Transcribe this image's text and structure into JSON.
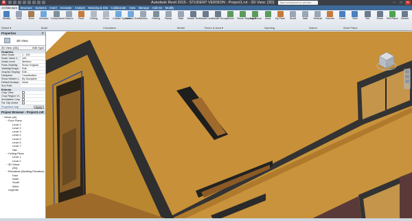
{
  "window": {
    "title": "Autodesk Revit 2016 - STUDENT VERSION -  Project1.rvt - 3D View: {3D}",
    "search_placeholder": "Type a keyword or phrase",
    "app_icon": "R"
  },
  "tabs": [
    "Architecture",
    "Structure",
    "Systems",
    "Insert",
    "Annotate",
    "Analyze",
    "Massing & Site",
    "Collaborate",
    "View",
    "Manage",
    "Add-Ins",
    "Modify"
  ],
  "active_tab": "Architecture",
  "ribbon": {
    "buttons": [
      {
        "label": "Modify",
        "icon": "cursor-icon",
        "color": "#4a7fc1"
      },
      {
        "label": "Wall",
        "icon": "wall-icon",
        "color": "#9aa6b5"
      },
      {
        "label": "Door",
        "icon": "door-icon",
        "color": "#a67c52"
      },
      {
        "label": "Window",
        "icon": "window-icon",
        "color": "#6fa8dc"
      },
      {
        "label": "Component",
        "icon": "component-icon",
        "color": "#7d8f9c"
      },
      {
        "label": "Column",
        "icon": "column-icon",
        "color": "#9aa6b5"
      },
      {
        "label": "Roof",
        "icon": "roof-icon",
        "color": "#c77a3b"
      },
      {
        "label": "Ceiling",
        "icon": "ceiling-icon",
        "color": "#b0bac6"
      },
      {
        "label": "Floor",
        "icon": "floor-icon",
        "color": "#b0bac6"
      },
      {
        "label": "Curtain System",
        "icon": "curtain-system-icon",
        "color": "#6fa8dc"
      },
      {
        "label": "Curtain Grid",
        "icon": "curtain-grid-icon",
        "color": "#6fa8dc"
      },
      {
        "label": "Mullion",
        "icon": "mullion-icon",
        "color": "#9aa6b5"
      },
      {
        "label": "Railing",
        "icon": "railing-icon",
        "color": "#7d8f9c"
      },
      {
        "label": "Ramp",
        "icon": "ramp-icon",
        "color": "#9aa6b5"
      },
      {
        "label": "Stair",
        "icon": "stair-icon",
        "color": "#9aa6b5"
      },
      {
        "label": "Model Text",
        "icon": "model-text-icon",
        "color": "#6b7a8d"
      },
      {
        "label": "Model Line",
        "icon": "model-line-icon",
        "color": "#6b7a8d"
      },
      {
        "label": "Model Group",
        "icon": "model-group-icon",
        "color": "#6b7a8d"
      },
      {
        "label": "Room",
        "icon": "room-icon",
        "color": "#5b9b5b"
      },
      {
        "label": "Room Separator",
        "icon": "room-separator-icon",
        "color": "#5b9b5b"
      },
      {
        "label": "Tag Room",
        "icon": "tag-room-icon",
        "color": "#5b9b5b"
      },
      {
        "label": "Area",
        "icon": "area-icon",
        "color": "#5b9b5b"
      },
      {
        "label": "By Face",
        "icon": "by-face-icon",
        "color": "#c77a3b"
      },
      {
        "label": "Shaft",
        "icon": "shaft-icon",
        "color": "#9aa6b5"
      },
      {
        "label": "Wall",
        "icon": "wall-opening-icon",
        "color": "#9aa6b5"
      },
      {
        "label": "Vertical",
        "icon": "vertical-icon",
        "color": "#9aa6b5"
      },
      {
        "label": "Dormer",
        "icon": "dormer-icon",
        "color": "#c77a3b"
      },
      {
        "label": "Level",
        "icon": "level-icon",
        "color": "#4a7fc1"
      },
      {
        "label": "Grid",
        "icon": "grid-icon",
        "color": "#4a7fc1"
      },
      {
        "label": "Set",
        "icon": "set-icon",
        "color": "#6b7a8d"
      },
      {
        "label": "Show",
        "icon": "show-icon",
        "color": "#6b7a8d"
      },
      {
        "label": "Ref Plane",
        "icon": "ref-plane-icon",
        "color": "#4fa34f"
      },
      {
        "label": "Viewer",
        "icon": "viewer-icon",
        "color": "#6b7a8d"
      }
    ],
    "panels": [
      "Select ▾",
      "Build",
      "Circulation",
      "Model",
      "Room & Area ▾",
      "Opening",
      "Datum",
      "Work Plane"
    ]
  },
  "properties": {
    "header": "Properties",
    "type_name": "3D View",
    "selector": "3D View: {3D}",
    "edit_type": "Edit Type",
    "group_graphics": "Graphics",
    "rows": [
      {
        "k": "View Scale",
        "v": "1 : 100"
      },
      {
        "k": "Scale Value  1:",
        "v": "100"
      },
      {
        "k": "Detail Level",
        "v": "Medium"
      },
      {
        "k": "Parts Visibility",
        "v": "Show Original"
      },
      {
        "k": "Visibility/Graph...",
        "v": "Edit..."
      },
      {
        "k": "Graphic Display ...",
        "v": "Edit..."
      },
      {
        "k": "Discipline",
        "v": "Coordination"
      },
      {
        "k": "Show Hidden L...",
        "v": "By Discipline"
      },
      {
        "k": "Default Analysi...",
        "v": "None"
      },
      {
        "k": "Sun Path",
        "v": ""
      }
    ],
    "group_extents": "Extents",
    "extent_rows": [
      {
        "k": "Crop View",
        "v": ""
      },
      {
        "k": "Crop Region Vi...",
        "v": ""
      },
      {
        "k": "Annotation Crop",
        "v": ""
      },
      {
        "k": "Far Clip Active",
        "v": ""
      }
    ],
    "help": "Properties help",
    "apply": "Apply"
  },
  "browser": {
    "header": "Project Browser - Project1.rvt",
    "items": [
      {
        "t": "Views (all)",
        "lvl": 0,
        "tog": "−"
      },
      {
        "t": "Floor Plans",
        "lvl": 1,
        "tog": "−"
      },
      {
        "t": "Level 1",
        "lvl": 2,
        "tog": ""
      },
      {
        "t": "Level 2",
        "lvl": 2,
        "tog": ""
      },
      {
        "t": "Level 3",
        "lvl": 2,
        "tog": ""
      },
      {
        "t": "Level 4",
        "lvl": 2,
        "tog": ""
      },
      {
        "t": "Level 5",
        "lvl": 2,
        "tog": ""
      },
      {
        "t": "Level 6",
        "lvl": 2,
        "tog": ""
      },
      {
        "t": "Level 7",
        "lvl": 2,
        "tog": ""
      },
      {
        "t": "Site",
        "lvl": 2,
        "tog": ""
      },
      {
        "t": "Ceiling Plans",
        "lvl": 1,
        "tog": "−"
      },
      {
        "t": "Level 1",
        "lvl": 2,
        "tog": ""
      },
      {
        "t": "Level 2",
        "lvl": 2,
        "tog": ""
      },
      {
        "t": "3D Views",
        "lvl": 1,
        "tog": "−"
      },
      {
        "t": "{3D}",
        "lvl": 2,
        "tog": ""
      },
      {
        "t": "Elevations (Building Elevation)",
        "lvl": 1,
        "tog": "−"
      },
      {
        "t": "East",
        "lvl": 2,
        "tog": ""
      },
      {
        "t": "North",
        "lvl": 2,
        "tog": ""
      },
      {
        "t": "South",
        "lvl": 2,
        "tog": ""
      },
      {
        "t": "West",
        "lvl": 2,
        "tog": ""
      },
      {
        "t": "Legends",
        "lvl": 1,
        "tog": ""
      }
    ]
  },
  "viewcube": {
    "face": "TOP"
  },
  "colors": {
    "wall": "#c8933c",
    "roof_edge": "#3a3a3a",
    "brick": "#5a3a38",
    "selection": "#1f3fae"
  }
}
